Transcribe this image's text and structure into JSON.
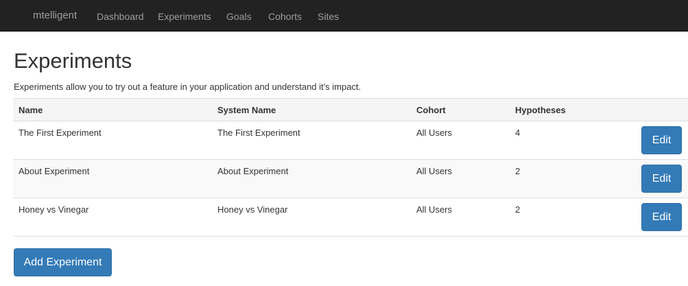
{
  "navbar": {
    "brand": "mtelligent",
    "links": [
      "Dashboard",
      "Experiments",
      "Goals",
      "Cohorts",
      "Sites"
    ]
  },
  "page": {
    "title": "Experiments",
    "description": "Experiments allow you to try out a feature in your application and understand it's impact."
  },
  "table": {
    "headers": [
      "Name",
      "System Name",
      "Cohort",
      "Hypotheses"
    ],
    "rows": [
      {
        "name": "The First Experiment",
        "system_name": "The First Experiment",
        "cohort": "All Users",
        "hypotheses": "4",
        "action": "Edit"
      },
      {
        "name": "About Experiment",
        "system_name": "About Experiment",
        "cohort": "All Users",
        "hypotheses": "2",
        "action": "Edit"
      },
      {
        "name": "Honey vs Vinegar",
        "system_name": "Honey vs Vinegar",
        "cohort": "All Users",
        "hypotheses": "2",
        "action": "Edit"
      }
    ]
  },
  "actions": {
    "add_label": "Add Experiment"
  },
  "colors": {
    "navbar_bg": "#222222",
    "primary": "#337ab7"
  }
}
